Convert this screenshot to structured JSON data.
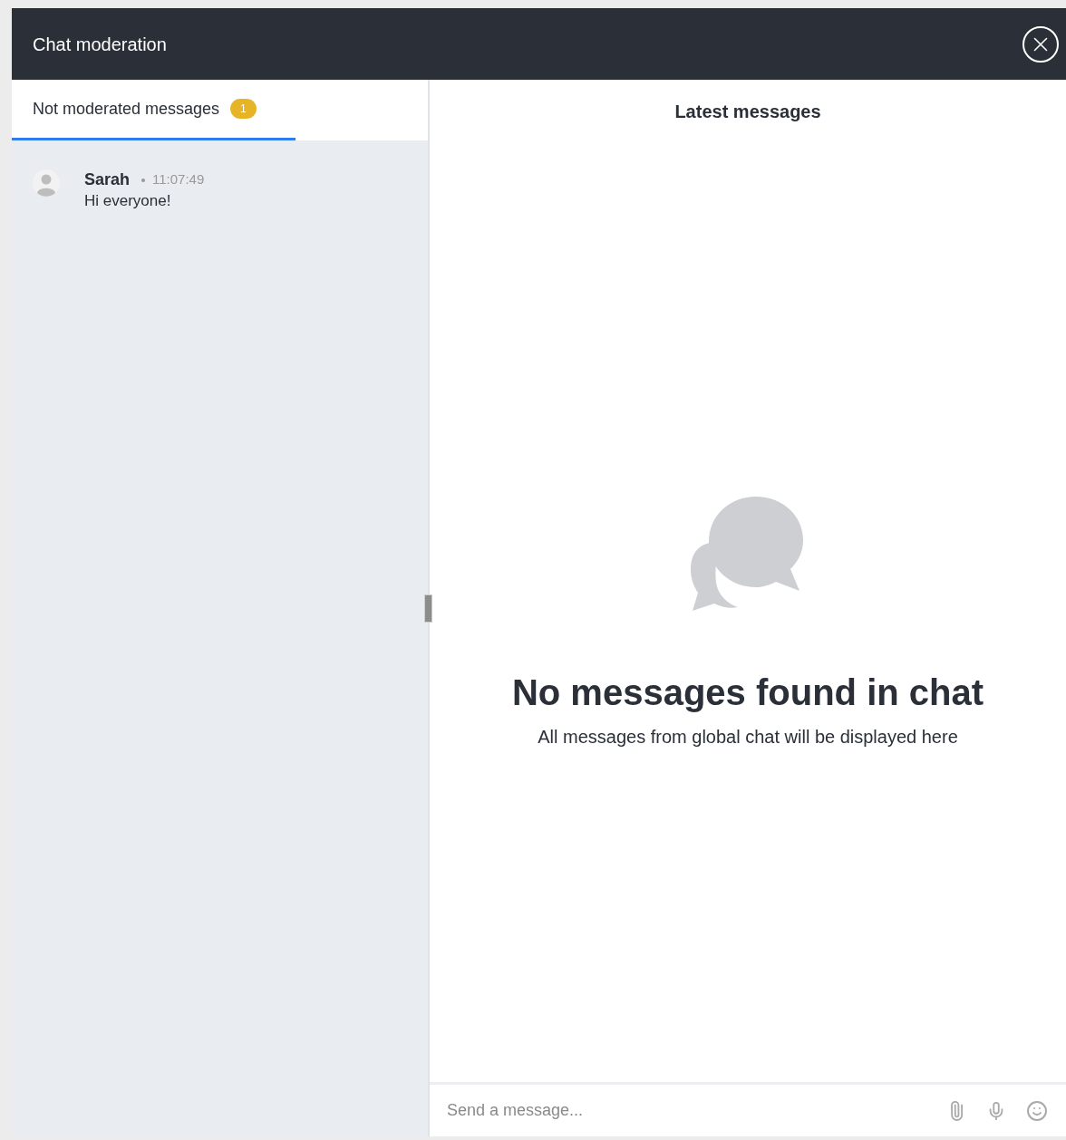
{
  "window": {
    "title": "Chat moderation"
  },
  "tabs": [
    {
      "label": "Not moderated messages",
      "badge": "1",
      "selected": true
    }
  ],
  "messages": [
    {
      "author": "Sarah",
      "time": "11:07:49",
      "text": "Hi everyone!"
    }
  ],
  "right_panel": {
    "title": "Latest messages",
    "empty_title": "No messages found in chat",
    "empty_text": "All messages from global chat will be displayed here"
  },
  "composer": {
    "placeholder": "Send a message..."
  }
}
